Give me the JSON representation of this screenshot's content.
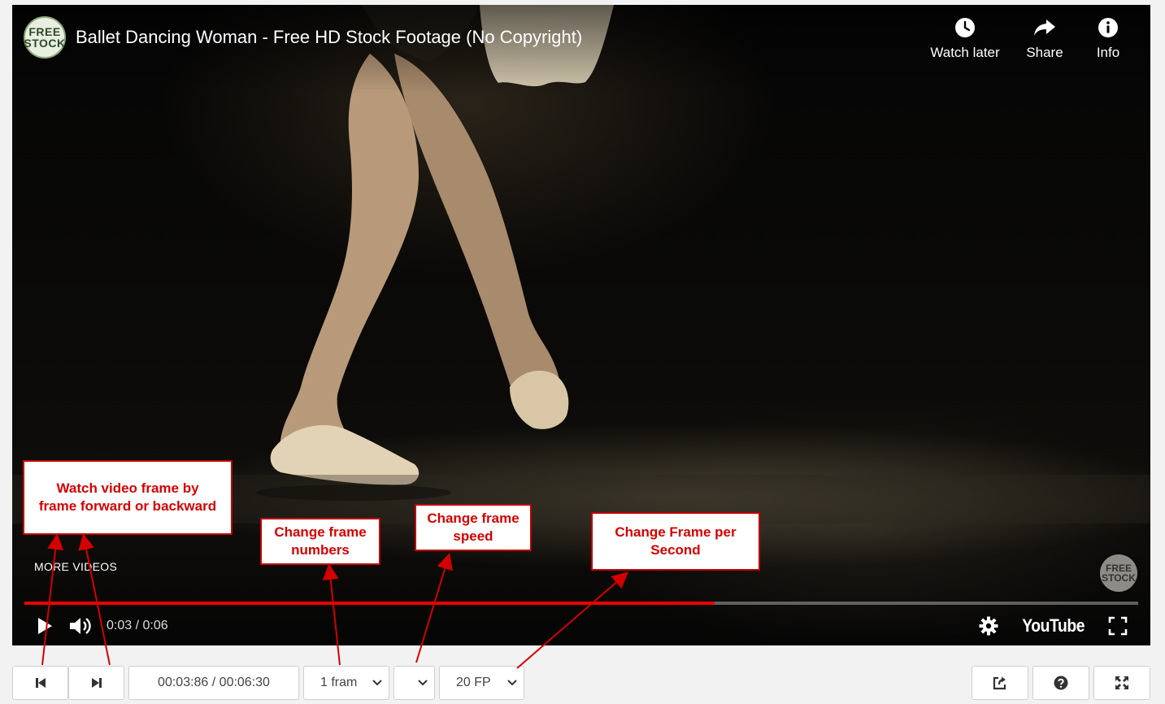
{
  "player": {
    "title": "Ballet Dancing Woman - Free HD Stock Footage (No Copyright)",
    "channel_logo_line1": "FREE",
    "channel_logo_line2": "STOCK",
    "actions": [
      {
        "label": "Watch later",
        "icon": "clock-icon"
      },
      {
        "label": "Share",
        "icon": "share-arrow-icon"
      },
      {
        "label": "Info",
        "icon": "info-icon"
      }
    ],
    "more_videos": "MORE VIDEOS",
    "watermark_line1": "FREE",
    "watermark_line2": "STOCK",
    "progress_fraction": 0.62,
    "time": "0:03 / 0:06",
    "youtube_label": "YouTube",
    "colors": {
      "progress": "#ee0000",
      "accent_annotation": "#d40000"
    }
  },
  "toolbar": {
    "prev_frame_icon": "skip-back-icon",
    "next_frame_icon": "skip-forward-icon",
    "timecode": "00:03:86 / 00:06:30",
    "frame_step": "1 fram",
    "speed": "",
    "fps": "20 FP",
    "right_icons": [
      "share-box-icon",
      "help-icon",
      "fullscreen-expand-icon"
    ]
  },
  "annotations": {
    "frame_by_frame": [
      "Watch video frame by",
      "frame forward or backward"
    ],
    "frame_numbers": [
      "Change frame",
      "numbers"
    ],
    "frame_speed": [
      "Change frame",
      "speed"
    ],
    "fps": [
      "Change Frame per",
      "Second"
    ]
  }
}
